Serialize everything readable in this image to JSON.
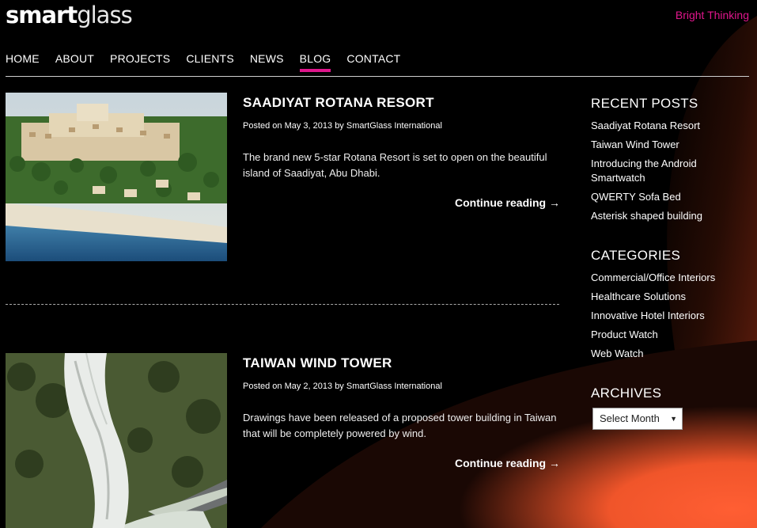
{
  "header": {
    "logo_bold": "smart",
    "logo_light": "glass",
    "tagline": "Bright Thinking"
  },
  "nav": [
    "HOME",
    "ABOUT",
    "PROJECTS",
    "CLIENTS",
    "NEWS",
    "BLOG",
    "CONTACT"
  ],
  "nav_active": "BLOG",
  "posts": [
    {
      "title": "SAADIYAT ROTANA RESORT",
      "meta": "Posted on May 3, 2013 by SmartGlass International",
      "excerpt": "The brand new 5-star Rotana Resort is set to open on the beautiful island of Saadiyat, Abu Dhabi.",
      "continue": "Continue reading →"
    },
    {
      "title": "TAIWAN WIND TOWER",
      "meta": "Posted on May 2, 2013 by SmartGlass International",
      "excerpt": "Drawings have been released of a proposed tower building in Taiwan that will be completely powered by wind.",
      "continue": "Continue reading →"
    }
  ],
  "sidebar": {
    "recent_title": "RECENT POSTS",
    "recent": [
      "Saadiyat Rotana Resort",
      "Taiwan Wind Tower",
      "Introducing the Android Smartwatch",
      "QWERTY Sofa Bed",
      "Asterisk shaped building"
    ],
    "categories_title": "CATEGORIES",
    "categories": [
      "Commercial/Office Interiors",
      "Healthcare Solutions",
      "Innovative Hotel Interiors",
      "Product Watch",
      "Web Watch"
    ],
    "archives_title": "ARCHIVES",
    "archives_select": "Select Month"
  },
  "colors": {
    "accent": "#e0168c",
    "glow": "#ff5a2a"
  }
}
